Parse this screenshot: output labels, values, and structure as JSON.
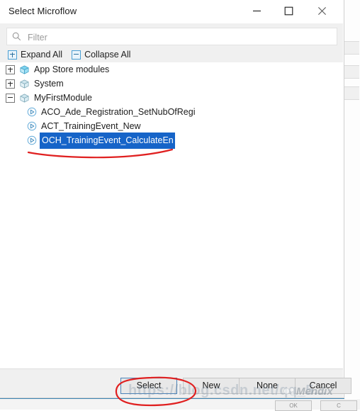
{
  "dialog": {
    "title": "Select Microflow",
    "window_controls": [
      {
        "name": "minimize",
        "glyph": "minimize-icon"
      },
      {
        "name": "maximize",
        "glyph": "maximize-icon"
      },
      {
        "name": "close",
        "glyph": "close-icon"
      }
    ]
  },
  "filter": {
    "value": "",
    "placeholder": "Filter",
    "icon": "search-icon"
  },
  "toolbar": {
    "expand_all_label": "Expand All",
    "collapse_all_label": "Collapse All",
    "expand_icon": "plus-box-icon",
    "collapse_icon": "minus-box-icon"
  },
  "tree": {
    "nodes": [
      {
        "label": "App Store modules",
        "type": "module",
        "icon": "module-cube-icon",
        "expanded": false,
        "twisty": "plus",
        "selected": false
      },
      {
        "label": "System",
        "type": "module",
        "icon": "module-cube-icon",
        "expanded": false,
        "twisty": "plus",
        "selected": false
      },
      {
        "label": "MyFirstModule",
        "type": "module",
        "icon": "module-cube-icon",
        "expanded": true,
        "twisty": "minus",
        "selected": false
      },
      {
        "label": "ACO_Ade_Registration_SetNubOfRegi",
        "type": "microflow",
        "icon": "microflow-icon",
        "selected": false
      },
      {
        "label": "ACT_TrainingEvent_New",
        "type": "microflow",
        "icon": "microflow-icon",
        "selected": false
      },
      {
        "label": "OCH_TrainingEvent_CalculateEn",
        "type": "microflow",
        "icon": "microflow-icon",
        "selected": true
      }
    ]
  },
  "footer": {
    "buttons": [
      {
        "label": "Select",
        "id": "select",
        "default": true
      },
      {
        "label": "New",
        "id": "new",
        "default": false
      },
      {
        "label": "None",
        "id": "none",
        "default": false
      },
      {
        "label": "Cancel",
        "id": "cancel",
        "default": false
      }
    ]
  },
  "background_window": {
    "buttons": [
      {
        "label": "OK"
      },
      {
        "label": "C"
      }
    ]
  },
  "watermarks": {
    "url": "https://blog.csdn.net/qq_5...",
    "brand": "Mendix"
  },
  "annotations": {
    "underline_target": "OCH_TrainingEvent_CalculateEn",
    "circle_target": "Select",
    "color": "#e02020"
  },
  "colors": {
    "selection_blue": "#1664c8",
    "accent_blue": "#4a82b8",
    "dialog_chrome": "#f0f0f0",
    "annotation_red": "#e02020"
  }
}
